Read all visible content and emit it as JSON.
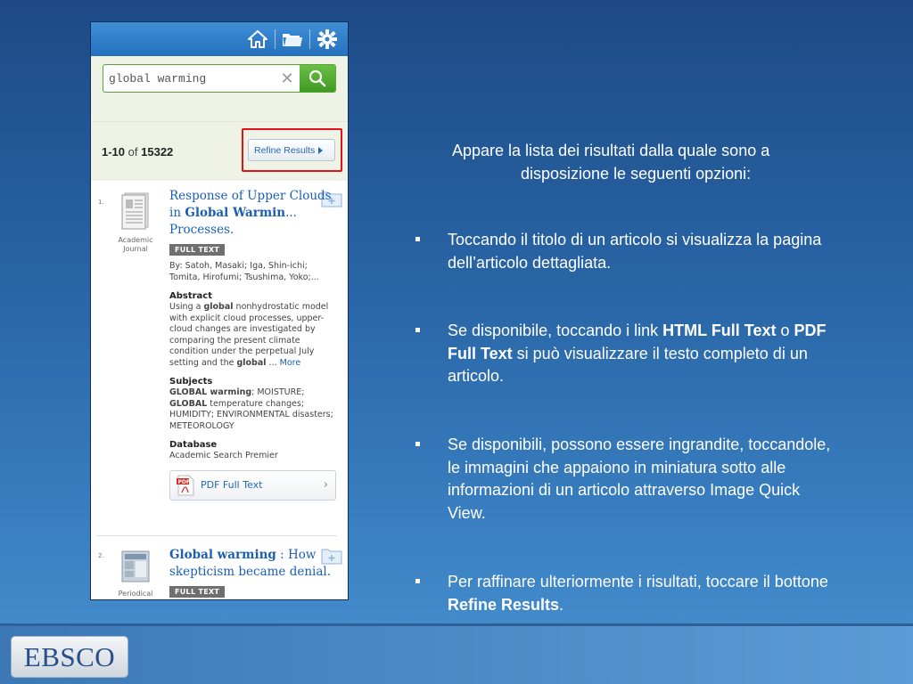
{
  "phone": {
    "search": {
      "value": "global warming",
      "clear_icon": "close-icon",
      "go_icon": "search-icon"
    },
    "topbar_icons": [
      "home-icon",
      "folder-icon",
      "gear-icon"
    ],
    "results_count": {
      "range": "1-10",
      "of": "of",
      "total": "15322"
    },
    "refine_button": "Refine Results",
    "results": [
      {
        "number": "1.",
        "type": "Academic Journal",
        "title_parts": [
          "Response of Upper Clouds in ",
          "Global Warmin",
          "... Processes."
        ],
        "badge": "FULL TEXT",
        "authors": "By: Satoh, Masaki; Iga, Shin-ichi; Tomita, Hirofumi; Tsushima, Yoko;...",
        "abstract_label": "Abstract",
        "abstract": [
          "Using a ",
          "global",
          " nonhydrostatic model with explicit cloud processes, upper-cloud changes are investigated by comparing the present climate condition under the perpetual July setting and the ",
          "global",
          " ... "
        ],
        "more": "More",
        "subjects_label": "Subjects",
        "subjects": [
          "GLOBAL warming",
          "; MOISTURE; ",
          "GLOBAL",
          " temperature changes; HUMIDITY; ENVIRONMENTAL disasters; METEOROLOGY"
        ],
        "database_label": "Database",
        "database": "Academic Search Premier",
        "pdf_link": "PDF Full Text"
      },
      {
        "number": "2.",
        "type": "Periodical",
        "title_parts": [
          "Global warming",
          " : How skepticism became denial."
        ],
        "badge": "FULL TEXT"
      }
    ]
  },
  "slide": {
    "intro_line1": "Appare la lista dei risultati dalla quale sono a",
    "intro_line2": "disposizione le seguenti opzioni:",
    "bullet1": "Toccando il titolo di un articolo si visualizza la pagina dell’articolo dettagliata.",
    "bullet2": {
      "pre": "Se disponibile, toccando i link ",
      "b1": "HTML Full Text",
      "mid": " o ",
      "b2": "PDF Full Text",
      "post": " si può visualizzare il testo completo di un articolo."
    },
    "bullet3": "Se disponibili, possono essere ingrandite, toccandole, le immagini che appaiono in miniatura sotto alle informazioni di un articolo attraverso Image Quick View.",
    "bullet4": {
      "pre": "Per raffinare ulteriormente i risultati, toccare il bottone ",
      "bold": "Refine Results",
      "post": "."
    }
  },
  "footer": {
    "logo": "EBSCO"
  }
}
